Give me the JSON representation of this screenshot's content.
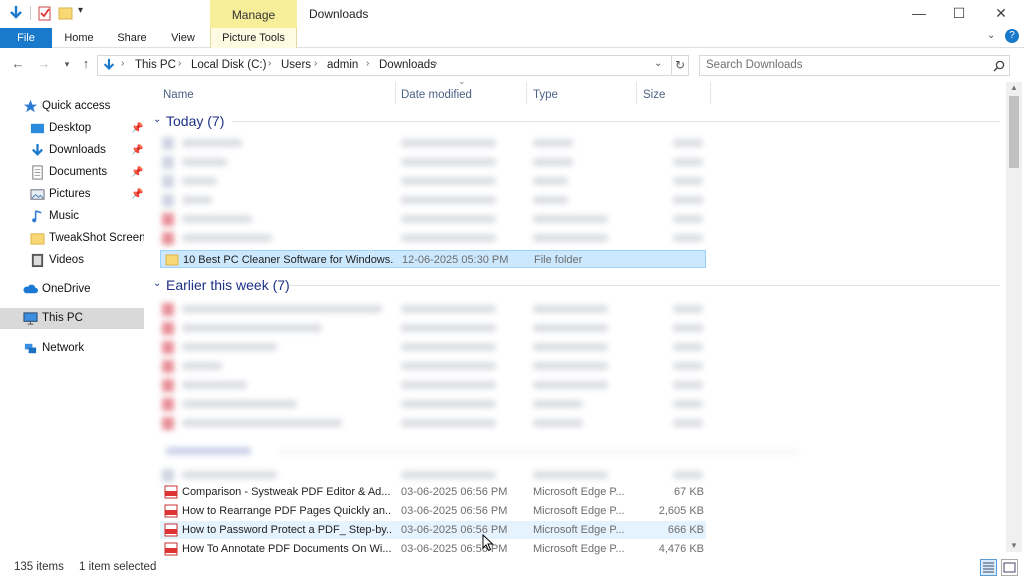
{
  "window": {
    "title": "Downloads",
    "contextual_tab": "Manage",
    "controls": {
      "minimize": "—",
      "maximize": "☐",
      "close": "✕"
    }
  },
  "ribbon": {
    "tabs": [
      {
        "label": "File"
      },
      {
        "label": "Home"
      },
      {
        "label": "Share"
      },
      {
        "label": "View"
      },
      {
        "label": "Picture Tools"
      }
    ]
  },
  "address": {
    "crumbs": [
      "This PC",
      "Local Disk (C:)",
      "Users",
      "admin",
      "Downloads"
    ],
    "search_placeholder": "Search Downloads"
  },
  "sidebar": {
    "items": [
      {
        "label": "Quick access",
        "icon": "star-icon",
        "pinned": false
      },
      {
        "label": "Desktop",
        "icon": "desktop-icon",
        "pinned": true
      },
      {
        "label": "Downloads",
        "icon": "download-icon",
        "pinned": true
      },
      {
        "label": "Documents",
        "icon": "document-icon",
        "pinned": true
      },
      {
        "label": "Pictures",
        "icon": "picture-icon",
        "pinned": true
      },
      {
        "label": "Music",
        "icon": "music-icon",
        "pinned": false
      },
      {
        "label": "TweakShot Screen C",
        "icon": "folder-icon",
        "pinned": false
      },
      {
        "label": "Videos",
        "icon": "video-icon",
        "pinned": false
      },
      {
        "label": "OneDrive",
        "icon": "cloud-icon",
        "pinned": false
      },
      {
        "label": "This PC",
        "icon": "computer-icon",
        "pinned": false
      },
      {
        "label": "Network",
        "icon": "network-icon",
        "pinned": false
      }
    ]
  },
  "columns": {
    "name": "Name",
    "date": "Date modified",
    "type": "Type",
    "size": "Size"
  },
  "groups": {
    "today": "Today (7)",
    "earlier": "Earlier this week (7)"
  },
  "selected_folder": {
    "name": "10 Best PC Cleaner Software for Windows...",
    "date": "12-06-2025 05:30 PM",
    "type": "File folder",
    "size": ""
  },
  "files": [
    {
      "name": "Comparison - Systweak PDF Editor & Ad...",
      "date": "03-06-2025 06:56 PM",
      "type": "Microsoft Edge P...",
      "size": "67 KB"
    },
    {
      "name": "How to Rearrange PDF Pages Quickly an...",
      "date": "03-06-2025 06:56 PM",
      "type": "Microsoft Edge P...",
      "size": "2,605 KB"
    },
    {
      "name": "How to Password Protect a PDF_ Step-by...",
      "date": "03-06-2025 06:56 PM",
      "type": "Microsoft Edge P...",
      "size": "666 KB"
    },
    {
      "name": "How To Annotate PDF Documents On Wi...",
      "date": "03-06-2025 06:56 PM",
      "type": "Microsoft Edge P...",
      "size": "4,476 KB"
    }
  ],
  "status": {
    "items": "135 items",
    "selected": "1 item selected"
  },
  "colors": {
    "accent": "#1979ca",
    "manage_tab": "#f7ee99",
    "selection": "#cce8ff",
    "group_label": "#1e3287"
  }
}
